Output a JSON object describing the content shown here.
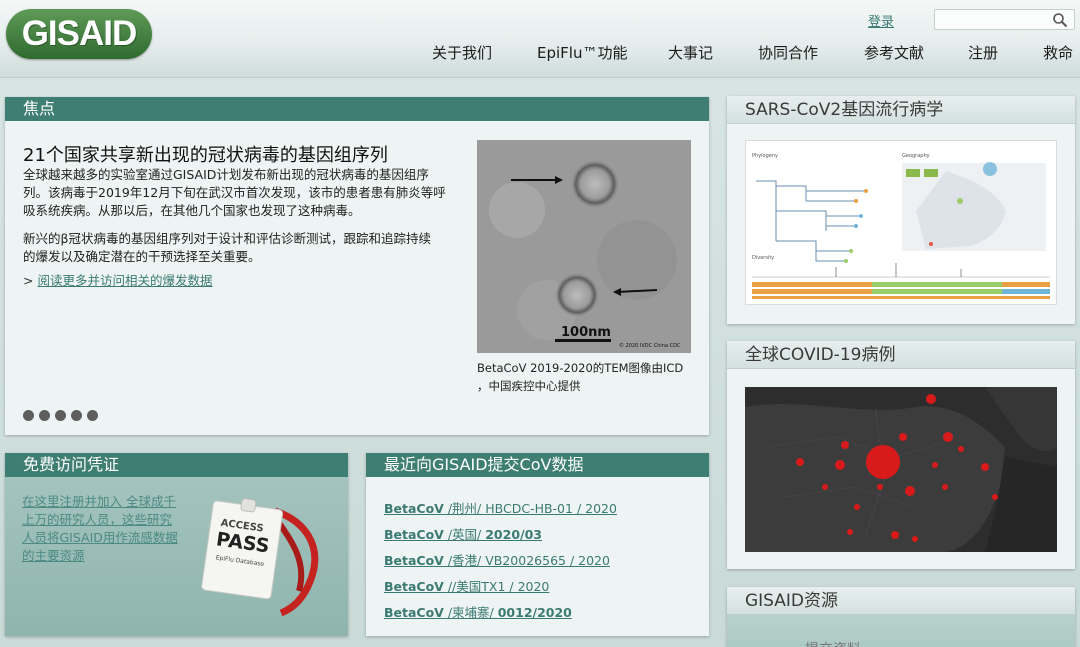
{
  "header": {
    "logo_text": "GISAID",
    "login": "登录",
    "search_placeholder": "",
    "nav": [
      "关于我们",
      "EpiFlu™功能",
      "大事记",
      "协同合作",
      "参考文献",
      "注册",
      "救命"
    ]
  },
  "focus": {
    "heading": "焦点",
    "title": "21个国家共享新出现的冠状病毒的基因组序列",
    "p1_lines": [
      "全球越来越多的实验室通过GISAID计划发布新出现的冠状病毒的基因组序",
      "列。该病毒于2019年12月下旬在武汉市首次发现，该市的患者患有肺炎等呼",
      "吸系统疾病。从那以后，在其他几个国家也发现了这种病毒。"
    ],
    "p2_lines": [
      "新兴的β冠状病毒的基因组序列对于设计和评估诊断测试，跟踪和追踪持续",
      "的爆发以及确定潜在的干预选择至关重要。"
    ],
    "read_more_prefix": "> ",
    "read_more": "阅读更多并访问相关的爆发数据",
    "image_scale": "100nm",
    "image_credit": "© 2020 IVDC China CDC",
    "caption_lines": [
      "BetaCoV 2019-2020的TEM图像由ICD",
      "，中国疾控中心提供"
    ],
    "slide_count": 5,
    "active_slide": 0
  },
  "access": {
    "heading": "免费访问凭证",
    "text_lines": [
      "在这里注册并加入 全球成千",
      "上万的研究人员，这些研究",
      "人员将GISAID用作流感数据",
      "的主要资源"
    ],
    "badge_line1": "ACCESS",
    "badge_line2": "PASS",
    "badge_line3": "EpiFlu Database"
  },
  "recent": {
    "heading": "最近向GISAID提交CoV数据",
    "items": [
      {
        "prefix": "BetaCoV",
        "rest": " /荆州/ HBCDC-HB-01 / 2020",
        "bold_tail": ""
      },
      {
        "prefix": "BetaCoV",
        "rest": " /英国/ ",
        "bold_tail": "2020/03"
      },
      {
        "prefix": "BetaCoV",
        "rest": " /香港/ VB20026565 / 2020",
        "bold_tail": ""
      },
      {
        "prefix": "BetaCoV",
        "rest": " //美国TX1 / 2020",
        "bold_tail": ""
      },
      {
        "prefix": "BetaCoV",
        "rest": " /柬埔寨/ ",
        "bold_tail": "0012/2020"
      }
    ]
  },
  "sidebar": {
    "epi_heading": "SARS-CoV2基因流行病学",
    "epi_labels": {
      "phylogeny": "Phylogeny",
      "geography": "Geography",
      "diversity": "Diversity"
    },
    "covid_heading": "全球COVID-19病例",
    "resources_heading": "GISAID资源",
    "resources_partial": "提交资料"
  },
  "colors": {
    "accent": "#3e7e73",
    "link": "#3b7a73",
    "logo": "#3e7a3a"
  }
}
